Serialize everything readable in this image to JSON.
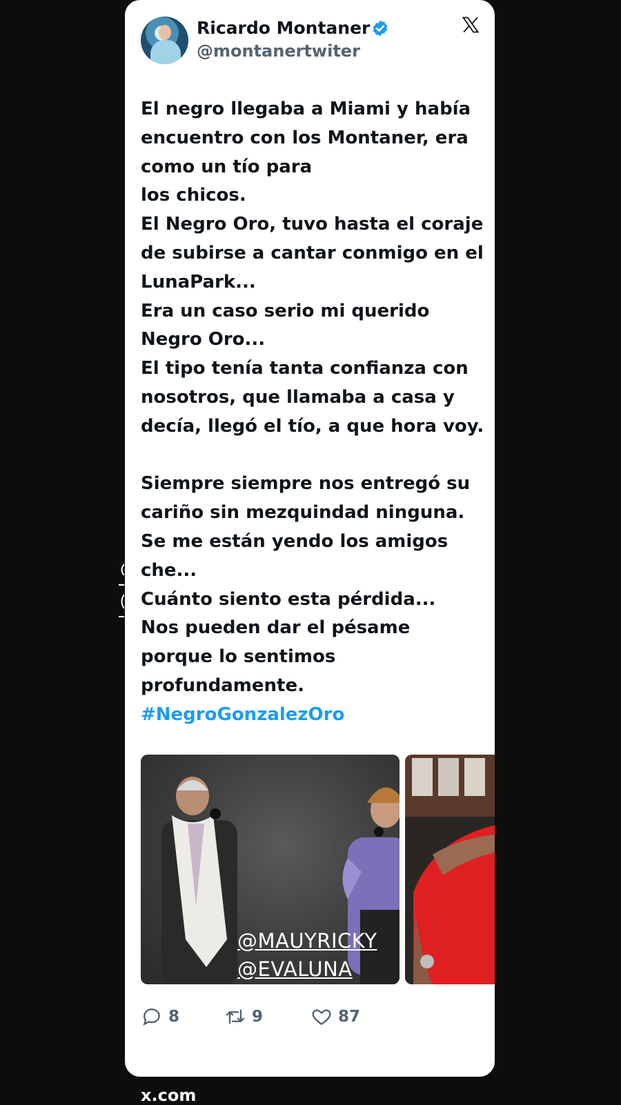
{
  "tweet": {
    "display_name": "Ricardo Montaner",
    "handle": "@montanertwiter",
    "text_lines": [
      "El negro llegaba a Miami y había",
      "encuentro con los Montaner, era",
      "como un tío para",
      "los chicos.",
      "El Negro Oro, tuvo hasta el coraje",
      "de subirse a cantar conmigo en el",
      "LunaPark...",
      "Era un caso serio mi querido",
      "Negro Oro...",
      "El tipo tenía tanta confianza con",
      "nosotros, que llamaba a casa y",
      "decía, llegó el tío, a que hora voy.",
      "",
      "Siempre siempre nos entregó su",
      "cariño sin mezquindad ninguna.",
      "Se me están yendo los amigos",
      "che...",
      "Cuánto siento esta pérdida...",
      "Nos pueden dar el pésame",
      "porque lo sentimos",
      "profundamente."
    ],
    "hashtag": "#NegroGonzalezOro",
    "media_overlay": {
      "mention_1": "@MAUYRICKY",
      "mention_2": "@EVALUNA"
    },
    "stats": {
      "replies": "8",
      "retweets": "9",
      "likes": "87"
    }
  },
  "icons": {
    "verified": "verified-badge-icon",
    "platform": "x-logo-icon",
    "reply": "reply-icon",
    "retweet": "retweet-icon",
    "like": "heart-icon"
  },
  "colors": {
    "background": "#0d0d0d",
    "card": "#ffffff",
    "text": "#0f1419",
    "secondary": "#536471",
    "accent": "#1d9bf0"
  },
  "footer": {
    "domain": "x.com"
  }
}
